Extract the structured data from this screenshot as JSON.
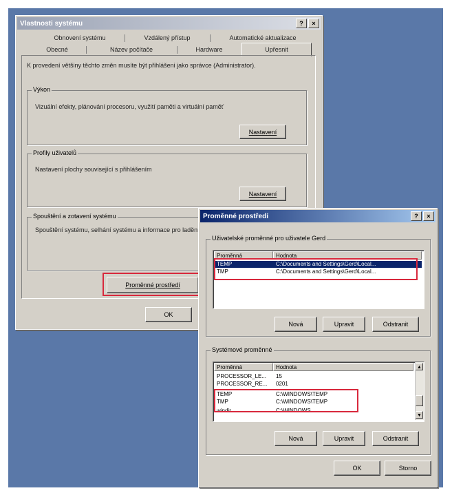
{
  "main_window": {
    "title": "Vlastnosti systému",
    "help_label": "?",
    "close_label": "×",
    "tabs_row1": [
      "Obnovení systému",
      "Vzdálený přístup",
      "Automatické aktualizace"
    ],
    "tabs_row2": [
      "Obecné",
      "Název počítače",
      "Hardware",
      "Upřesnit"
    ],
    "intro_text": "K provedení většiny těchto změn musíte být přihlášeni jako správce (Administrator).",
    "performance": {
      "label": "Výkon",
      "text": "Vizuální efekty, plánování procesoru, využití paměti a virtuální paměť",
      "button": "Nastavení"
    },
    "profiles": {
      "label": "Profily uživatelů",
      "text": "Nastavení plochy související s přihlášením",
      "button": "Nastavení"
    },
    "startup": {
      "label": "Spouštění a zotavení systému",
      "text": "Spouštění systému, selhání systému a informace pro ladění"
    },
    "env_button": "Proměnné prostředí",
    "ok_button": "OK"
  },
  "env_window": {
    "title": "Proměnné prostředí",
    "help_label": "?",
    "close_label": "×",
    "user_section": {
      "label": "Uživatelské proměnné pro uživatele Gerd",
      "headers": [
        "Proměnná",
        "Hodnota"
      ],
      "rows": [
        {
          "name": "TEMP",
          "value": "C:\\Documents and Settings\\Gerd\\Local..."
        },
        {
          "name": "TMP",
          "value": "C:\\Documents and Settings\\Gerd\\Local..."
        }
      ],
      "buttons": [
        "Nová",
        "Upravit",
        "Odstranit"
      ]
    },
    "system_section": {
      "label": "Systémové proměnné",
      "headers": [
        "Proměnná",
        "Hodnota"
      ],
      "rows": [
        {
          "name": "PROCESSOR_LE...",
          "value": "15"
        },
        {
          "name": "PROCESSOR_RE...",
          "value": "0201"
        },
        {
          "name": "TEMP",
          "value": "C:\\WINDOWS\\TEMP"
        },
        {
          "name": "TMP",
          "value": "C:\\WINDOWS\\TEMP"
        },
        {
          "name": "windir",
          "value": "C:\\WINDOWS"
        }
      ],
      "buttons": [
        "Nová",
        "Upravit",
        "Odstranit"
      ]
    },
    "ok_button": "OK",
    "cancel_button": "Storno"
  },
  "colors": {
    "desktop": "#5a78a8",
    "highlight": "#d8283c",
    "selection": "#0a246a",
    "dialog": "#d4d0c8"
  }
}
